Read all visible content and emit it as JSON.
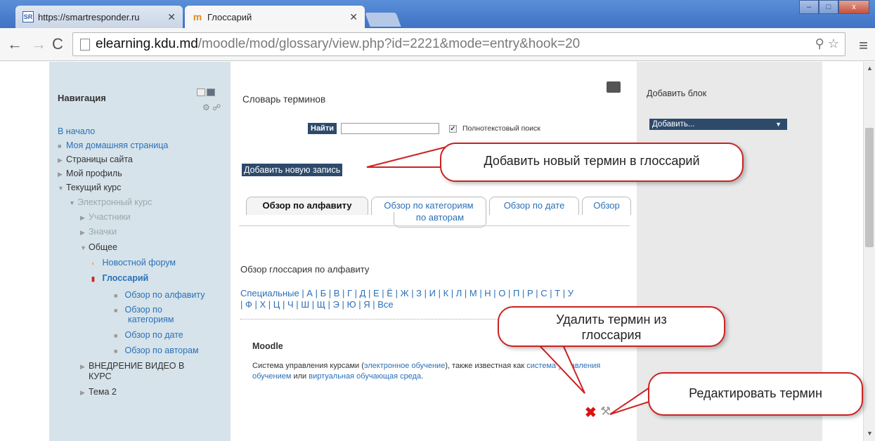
{
  "browser": {
    "tabs": [
      {
        "favicon": "SR",
        "title": "https://smartresponder.ru",
        "active": false
      },
      {
        "favicon": "moodle-icon",
        "title": "Глоссарий",
        "active": true
      }
    ],
    "url_host": "elearning.kdu.md",
    "url_path": "/moodle/mod/glossary/view.php?id=2221&mode=entry&hook=20",
    "window_buttons": [
      "–",
      "□",
      "x"
    ]
  },
  "navigation": {
    "title": "Навигация",
    "items": [
      {
        "label": "В начало"
      },
      {
        "label": "Моя домашняя страница"
      },
      {
        "label": "Страницы сайта"
      },
      {
        "label": "Мой профиль"
      },
      {
        "label": "Текущий курс"
      },
      {
        "label": "Электронный курс"
      },
      {
        "label": "Участники"
      },
      {
        "label": "Значки"
      },
      {
        "label": "Общее"
      },
      {
        "label": "Новостной форум"
      },
      {
        "label": "Глоссарий"
      },
      {
        "label": "Обзор по алфавиту"
      },
      {
        "label": "Обзор по"
      },
      {
        "label": "категориям"
      },
      {
        "label": "Обзор по дате"
      },
      {
        "label": "Обзор по авторам"
      },
      {
        "label": "ВНЕДРЕНИЕ ВИДЕО В"
      },
      {
        "label": "КУРС"
      },
      {
        "label": "Тема 2"
      }
    ]
  },
  "content": {
    "title": "Словарь терминов",
    "search_button": "Найти",
    "search_value": "",
    "fulltext_label": "Полнотекстовый поиск",
    "add_entry": "Добавить новую запись",
    "tabs": [
      "Обзор по алфавиту",
      "Обзор по категориям",
      "Обзор по дате",
      "Обзор",
      "по авторам"
    ],
    "browse_title": "Обзор глоссария по алфавиту",
    "alphabet_line1": "Специальные | А | Б | В | Г | Д | Е | Ё | Ж | З | И | К | Л | М | Н | О | П | Р | С | Т | У",
    "alphabet_line2": "| Ф | Х | Ц | Ч | Ш | Щ | Э | Ю | Я | Все",
    "entry_term": "Moodle",
    "entry_def_1": "Система управления курсами (",
    "entry_def_link1": "электронное обучение",
    "entry_def_2": "), также известная как ",
    "entry_def_link2": "система управления обучением",
    "entry_def_3": " или ",
    "entry_def_link3": "виртуальная обучающая среда",
    "entry_def_4": "."
  },
  "right_block": {
    "title": "Добавить блок",
    "select_value": "Добавить..."
  },
  "callouts": {
    "add_term": "Добавить новый термин в глоссарий",
    "delete_term_1": "Удалить термин  из",
    "delete_term_2": "глоссария",
    "edit_term": "Редактировать термин"
  },
  "colors": {
    "accent": "#2d4a6b",
    "link": "#2a70b8",
    "callout_border": "#cc2222",
    "nav_bg": "#d6e3ea"
  }
}
